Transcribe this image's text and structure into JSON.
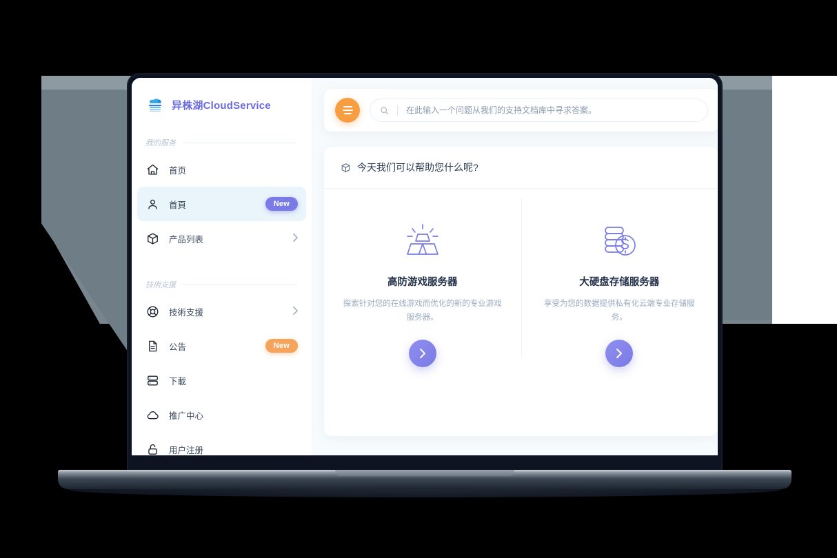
{
  "brand": {
    "logo_icon": "cloud-logo-icon",
    "title": "异株湖CloudService"
  },
  "sidebar": {
    "groups": [
      {
        "label": "我的服务"
      },
      {
        "label": "技術支援"
      }
    ],
    "items": [
      {
        "label": "首页",
        "icon": "home-icon",
        "badge": "",
        "chevron": false,
        "active": false
      },
      {
        "label": "首頁",
        "icon": "user-icon",
        "badge": "New",
        "badge_color": "#7b7be8",
        "chevron": false,
        "active": true
      },
      {
        "label": "产品列表",
        "icon": "cube-icon",
        "badge": "",
        "chevron": true,
        "active": false
      },
      {
        "label": "技術支援",
        "icon": "lifebuoy-icon",
        "badge": "",
        "chevron": true,
        "active": false
      },
      {
        "label": "公告",
        "icon": "document-icon",
        "badge": "New",
        "badge_color": "#f6a35c",
        "chevron": false,
        "active": false
      },
      {
        "label": "下載",
        "icon": "server-icon",
        "badge": "",
        "chevron": false,
        "active": false
      },
      {
        "label": "推广中心",
        "icon": "cloud-icon",
        "badge": "",
        "chevron": false,
        "active": false
      },
      {
        "label": "用户注册",
        "icon": "unlock-icon",
        "badge": "",
        "chevron": false,
        "active": false
      }
    ]
  },
  "topbar": {
    "menu_icon": "hamburger-menu-icon",
    "search_icon": "search-icon",
    "search_value": "",
    "search_placeholder": "在此输入一个问题从我们的支持文档库中寻求答案。"
  },
  "panel": {
    "icon": "cube-outline-icon",
    "title": "今天我们可以帮助您什么呢?",
    "cards": [
      {
        "icon": "gold-bars-icon",
        "title": "高防游戏服务器",
        "desc": "探索针对您的在线游戏而优化的新的专业游戏服务器。",
        "action_icon": "chevron-right-icon"
      },
      {
        "icon": "disk-stack-coin-icon",
        "title": "大硬盘存储服务器",
        "desc": "享受为您的数据提供私有化云端专业存储服务。",
        "action_icon": "chevron-right-icon"
      }
    ]
  },
  "colors": {
    "brand_purple": "#6b6be0",
    "accent_orange": "#f79e43",
    "badge_purple": "#7b7be8",
    "badge_orange": "#f6a35c",
    "icon_purple": "#7b7be8",
    "active_bg": "#eaf4fb"
  }
}
